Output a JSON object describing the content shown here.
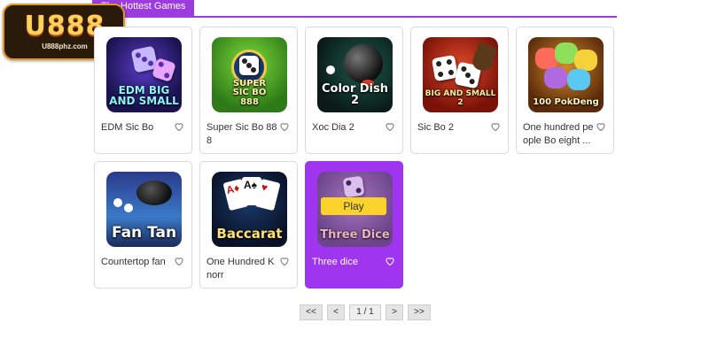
{
  "logo": {
    "main": "U888",
    "sub": "U888phz.com"
  },
  "tab": {
    "label": "The Hottest Games"
  },
  "games": [
    {
      "name": "EDM Sic Bo",
      "art": "EDM\nBIG AND SMALL"
    },
    {
      "name": "Super Sic Bo 888",
      "art": "SUPER\nSIC BO\n888"
    },
    {
      "name": "Xoc Dia 2",
      "art": "Color Dish 2"
    },
    {
      "name": "Sic Bo 2",
      "art": "BIG AND SMALL 2"
    },
    {
      "name": "One hundred people Bo eight ...",
      "art": "100 PokDeng"
    },
    {
      "name": "Countertop fan",
      "art": "Fan Tan"
    },
    {
      "name": "One Hundred Knorr",
      "art": "Baccarat"
    },
    {
      "name": "Three dice",
      "art": "Three Dice",
      "play_label": "Play"
    }
  ],
  "pager": {
    "first": "<<",
    "prev": "<",
    "current": "1 / 1",
    "next": ">",
    "last": ">>"
  },
  "colors": {
    "accent": "#9c3ce0",
    "active_card": "#a035f0",
    "play": "#fbd12c"
  }
}
